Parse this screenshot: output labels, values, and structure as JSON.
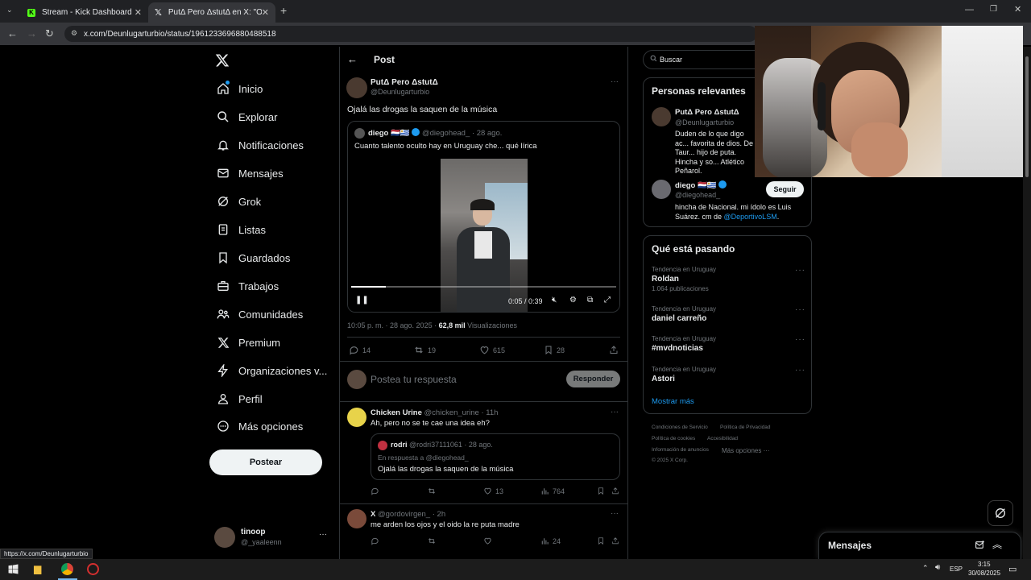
{
  "browser": {
    "tabs": [
      {
        "title": "Stream - Kick Dashboard",
        "icon": "kick-logo"
      },
      {
        "title": "PutΔ Pero ΔstutΔ en X: \"Ojalá l",
        "icon": "x-logo"
      }
    ],
    "new_tab": "+",
    "url": "x.com/Deunlugarturbio/status/1961233696880488518",
    "status_url": "https://x.com/Deunlugarturbio"
  },
  "nav": {
    "items": [
      {
        "label": "Inicio",
        "icon": "home-icon"
      },
      {
        "label": "Explorar",
        "icon": "search-icon"
      },
      {
        "label": "Notificaciones",
        "icon": "bell-icon"
      },
      {
        "label": "Mensajes",
        "icon": "mail-icon"
      },
      {
        "label": "Grok",
        "icon": "grok-icon"
      },
      {
        "label": "Listas",
        "icon": "list-icon"
      },
      {
        "label": "Guardados",
        "icon": "bookmark-icon"
      },
      {
        "label": "Trabajos",
        "icon": "briefcase-icon"
      },
      {
        "label": "Comunidades",
        "icon": "people-icon"
      },
      {
        "label": "Premium",
        "icon": "x-logo-icon"
      },
      {
        "label": "Organizaciones v...",
        "icon": "lightning-icon"
      },
      {
        "label": "Perfil",
        "icon": "person-icon"
      },
      {
        "label": "Más opciones",
        "icon": "more-circle-icon"
      }
    ],
    "post_button": "Postear",
    "account": {
      "name": "tinoop",
      "handle": "@_yaaleenn"
    }
  },
  "header": {
    "title": "Post"
  },
  "post": {
    "author_name": "PutΔ Pero ΔstutΔ",
    "author_handle": "@Deunlugarturbio",
    "text": "Ojalá las drogas la saquen de la música",
    "quote": {
      "name": "diego",
      "flags": "🇳🇱🇺🇾",
      "handle": "@diegohead_",
      "time": "· 28 ago.",
      "text": "Cuanto talento oculto hay en Uruguay che... qué lírica",
      "video_time": "0:05 / 0:39",
      "video_progress": 0.13
    },
    "timestamp": "10:05 p. m. · 28 ago. 2025 ·",
    "views_count": "62,8 mil",
    "views_label": "Visualizaciones",
    "stats": {
      "replies": "14",
      "reposts": "19",
      "likes": "615",
      "bookmarks": "28"
    }
  },
  "reply_box": {
    "placeholder": "Postea tu respuesta",
    "button": "Responder"
  },
  "replies": [
    {
      "name": "Chicken Urine",
      "handle": "@chicken_urine",
      "time": "· 11h",
      "text": "Ah, pero no se te cae una idea eh?",
      "quote": {
        "name": "rodri",
        "handle": "@rodri37111061",
        "time": "· 28 ago.",
        "reply_to": "En respuesta a @diegohead_",
        "text": "Ojalá las drogas la saquen de la música"
      },
      "stats": {
        "likes": "13",
        "views": "764"
      }
    },
    {
      "name": "X",
      "handle": "@gordovirgen_",
      "time": "· 2h",
      "text": "me arden los ojos y el oido la re puta madre",
      "stats": {
        "views": "24"
      }
    }
  ],
  "sidebar": {
    "search_placeholder": "Buscar",
    "relevant": {
      "title": "Personas relevantes",
      "people": [
        {
          "name": "PutΔ Pero ΔstutΔ",
          "handle": "@Deunlugarturbio",
          "bio": "Duden de lo que digo ac... favorita de dios. De Taur... hijo de puta. Hincha y so... Atlético Peñarol."
        },
        {
          "name": "diego",
          "flags": "🇳🇱🇺🇾",
          "handle": "@diegohead_",
          "bio_prefix": "hincha de Nacional. mi ídolo es Luis Suárez. cm de ",
          "bio_link": "@DeportivoLSM",
          "bio_suffix": ".",
          "follow": "Seguir"
        }
      ]
    },
    "trends": {
      "title": "Qué está pasando",
      "items": [
        {
          "context": "Tendencia en Uruguay",
          "name": "Roldan",
          "count": "1.064 publicaciones"
        },
        {
          "context": "Tendencia en Uruguay",
          "name": "daniel carreño",
          "count": ""
        },
        {
          "context": "Tendencia en Uruguay",
          "name": "#mvdnoticias",
          "count": ""
        },
        {
          "context": "Tendencia en Uruguay",
          "name": "Astori",
          "count": ""
        }
      ],
      "show_more": "Mostrar más"
    },
    "footer": {
      "links": [
        "Condiciones de Servicio",
        "Política de Privacidad",
        "Política de cookies",
        "Accesibilidad",
        "Información de anuncios",
        "Más opciones ···"
      ],
      "copyright": "© 2025 X Corp."
    }
  },
  "messages_drawer": {
    "title": "Mensajes"
  },
  "taskbar": {
    "lang": "ESP",
    "time": "3:15",
    "date": "30/08/2025"
  },
  "colors": {
    "accent": "#1d9bf0",
    "bg": "#000000",
    "border": "#2f3336",
    "muted": "#71767b"
  }
}
